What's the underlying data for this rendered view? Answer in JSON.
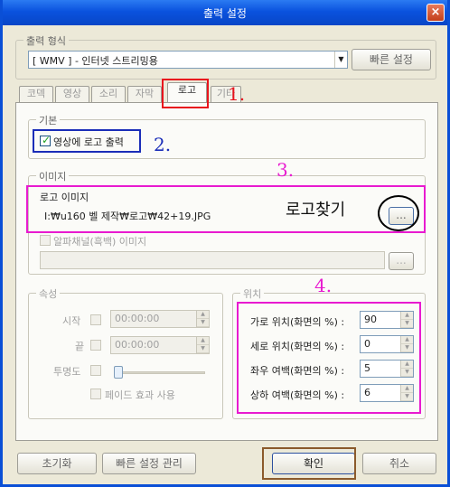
{
  "window": {
    "title": "출력 설정",
    "close": "×"
  },
  "output_format": {
    "legend": "출력 형식",
    "value": "[ WMV ] - 인터넷 스트리밍용",
    "quick_setup": "빠른 설정"
  },
  "tabs": [
    "코덱",
    "영상",
    "소리",
    "자막",
    "로고",
    "기타"
  ],
  "basic": {
    "legend": "기본",
    "checkbox_label": "영상에 로고 출력",
    "checked": true
  },
  "image": {
    "legend": "이미지",
    "logo_label": "로고 이미지",
    "logo_path": "I:₩u160 벨 제작₩로고₩42+19.JPG",
    "browse": "...",
    "alpha_label": "알파채널(흑백) 이미지",
    "alpha_browse": "..."
  },
  "attributes": {
    "legend": "속성",
    "start_label": "시작",
    "start_value": "00:00:00",
    "end_label": "끝",
    "end_value": "00:00:00",
    "transparency_label": "투명도",
    "fade_label": "페이드 효과 사용"
  },
  "position": {
    "legend": "위치",
    "rows": [
      {
        "label": "가로 위치(화면의 %) :",
        "value": "90"
      },
      {
        "label": "세로 위치(화면의 %) :",
        "value": "0"
      },
      {
        "label": "좌우 여백(화면의 %) :",
        "value": "5"
      },
      {
        "label": "상하 여백(화면의 %) :",
        "value": "6"
      }
    ]
  },
  "footer": {
    "reset": "초기화",
    "manage": "빠른 설정 관리",
    "ok": "확인",
    "cancel": "취소"
  },
  "annotations": {
    "n1": "1.",
    "n2": "2.",
    "n3": "3.",
    "n4": "4.",
    "find_logo": "로고찾기"
  },
  "colors": {
    "annot_red": "#e8141d",
    "annot_blue": "#1a2db8",
    "annot_magenta": "#e81ad0",
    "annot_brown": "#8b5a2b",
    "titlebar": "#0a52de"
  }
}
